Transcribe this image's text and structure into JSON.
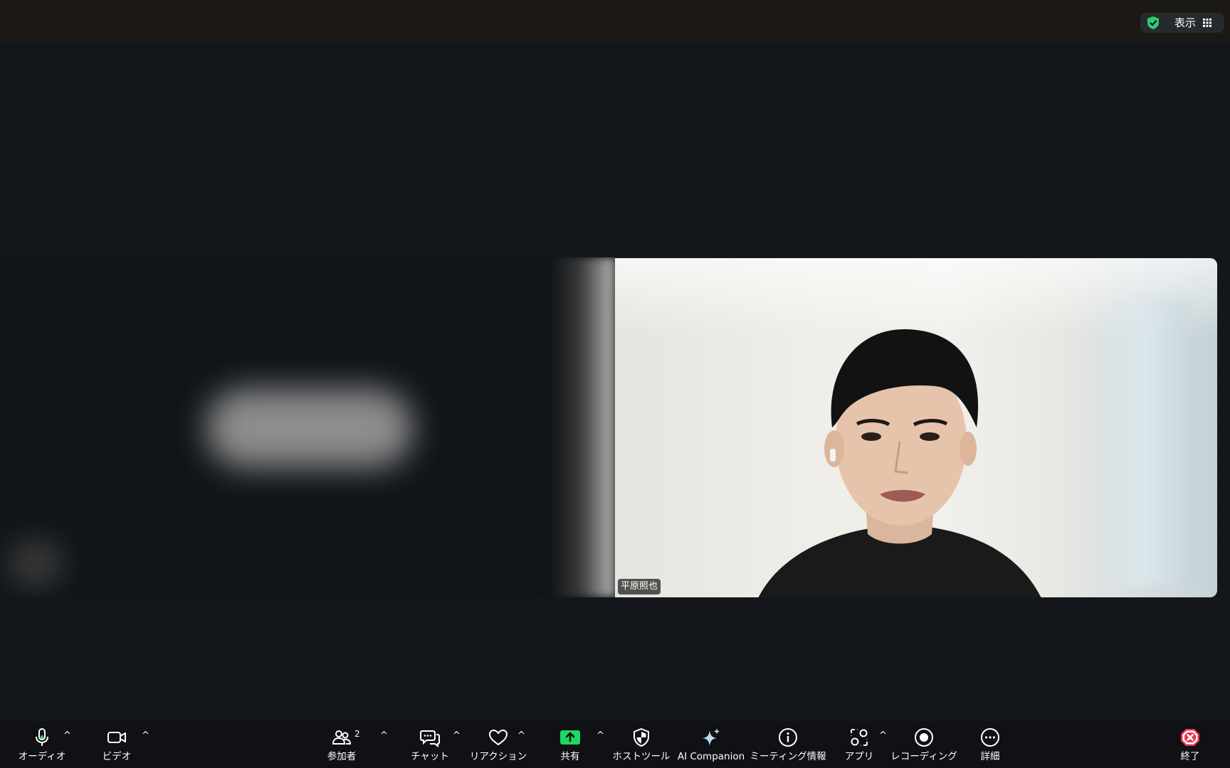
{
  "topbar": {
    "view_label": "表示",
    "security_color": "#2ecc71"
  },
  "participants": {
    "active_speaker_name": "平原照也"
  },
  "toolbar": {
    "audio": "オーディオ",
    "video": "ビデオ",
    "participants": "参加者",
    "participants_count": "2",
    "chat": "チャット",
    "reactions": "リアクション",
    "share": "共有",
    "host_tools": "ホストツール",
    "ai_companion": "AI Companion",
    "meeting_info": "ミーティング情報",
    "apps": "アプリ",
    "recording": "レコーディング",
    "more": "詳細",
    "end": "終了",
    "caret_symbol": "^",
    "share_color": "#1ed760",
    "end_color": "#e8394b",
    "mic_level_color": "#1ed760"
  }
}
